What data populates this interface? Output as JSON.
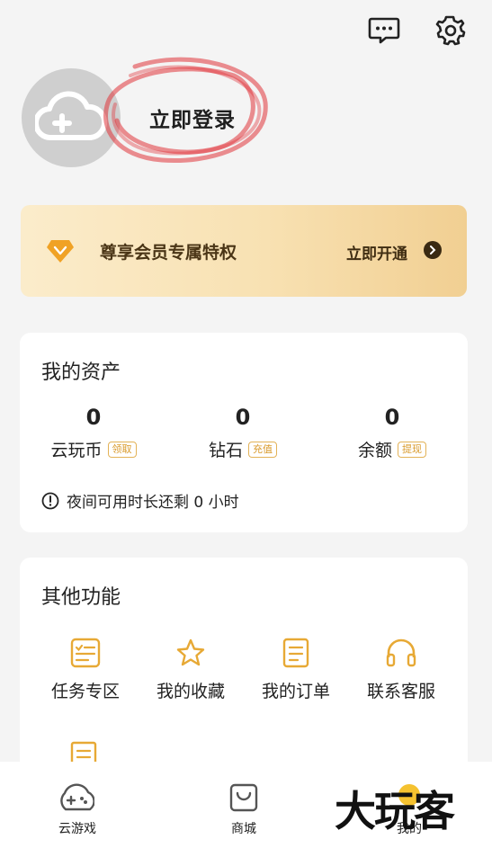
{
  "header": {
    "icons": [
      "message-icon",
      "settings-icon"
    ]
  },
  "profile": {
    "login_label": "立即登录"
  },
  "vip": {
    "title": "尊享会员专属特权",
    "action": "立即开通"
  },
  "assets": {
    "title": "我的资产",
    "items": [
      {
        "value": "0",
        "label": "云玩币",
        "tag": "领取"
      },
      {
        "value": "0",
        "label": "钻石",
        "tag": "充值"
      },
      {
        "value": "0",
        "label": "余额",
        "tag": "提现"
      }
    ],
    "notice": "夜间可用时长还剩 0 小时"
  },
  "functions": {
    "title": "其他功能",
    "items": [
      {
        "label": "任务专区",
        "icon": "task-list-icon"
      },
      {
        "label": "我的收藏",
        "icon": "star-icon"
      },
      {
        "label": "我的订单",
        "icon": "document-icon"
      },
      {
        "label": "联系客服",
        "icon": "headphones-icon"
      }
    ]
  },
  "tabbar": {
    "items": [
      {
        "label": "云游戏",
        "icon": "gamepad-icon"
      },
      {
        "label": "商城",
        "icon": "shopping-bag-icon"
      },
      {
        "label": "我的",
        "icon": "profile-icon"
      }
    ]
  },
  "watermark": "大玩客",
  "colors": {
    "accent": "#e7a935",
    "vip_bg": "#f8e1b2",
    "scribble": "#e0353b"
  }
}
